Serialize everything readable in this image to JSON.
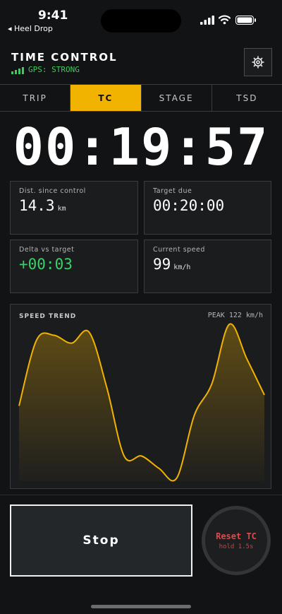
{
  "status": {
    "time": "9:41",
    "back_label": "◂ Heel Drop"
  },
  "header": {
    "title": "TIME CONTROL",
    "gps": "GPS: STRONG"
  },
  "tabs": [
    {
      "label": "TRIP"
    },
    {
      "label": "TC",
      "active": true
    },
    {
      "label": "STAGE"
    },
    {
      "label": "TSD"
    }
  ],
  "clock": "00:19:57",
  "stats": {
    "dist": {
      "label": "Dist. since control",
      "value": "14.3",
      "unit": "km"
    },
    "due": {
      "label": "Target due",
      "value": "00:20:00"
    },
    "delta": {
      "label": "Delta vs target",
      "value": "+00:03"
    },
    "speed": {
      "label": "Current speed",
      "value": "99",
      "unit": "km/h"
    }
  },
  "chart_data": {
    "type": "area",
    "title": "SPEED TREND",
    "peak_label": "PEAK 122 km/h",
    "peak": 122,
    "values": [
      48,
      90,
      93,
      88,
      95,
      60,
      16,
      16,
      8,
      2,
      42,
      62,
      100,
      78,
      55
    ],
    "color": "#f2b300"
  },
  "buttons": {
    "stop": "Stop",
    "reset": "Reset TC",
    "reset_hint": "hold 1.5s"
  },
  "colors": {
    "accent": "#f2b300",
    "positive": "#3bd06b",
    "danger": "#e0484a"
  }
}
